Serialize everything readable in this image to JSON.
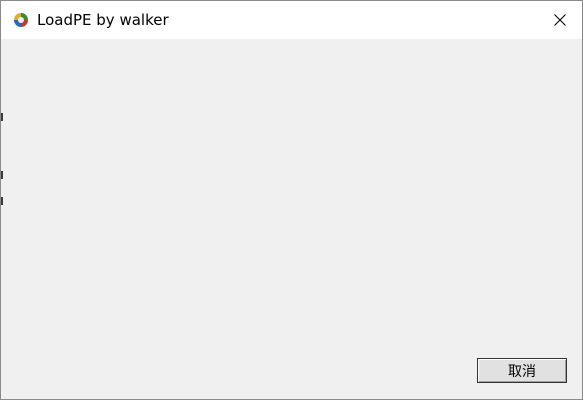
{
  "window": {
    "title": "LoadPE by walker",
    "icon": "loadpe-app-icon",
    "close_icon": "close-icon"
  },
  "buttons": {
    "cancel_label": "取消"
  }
}
